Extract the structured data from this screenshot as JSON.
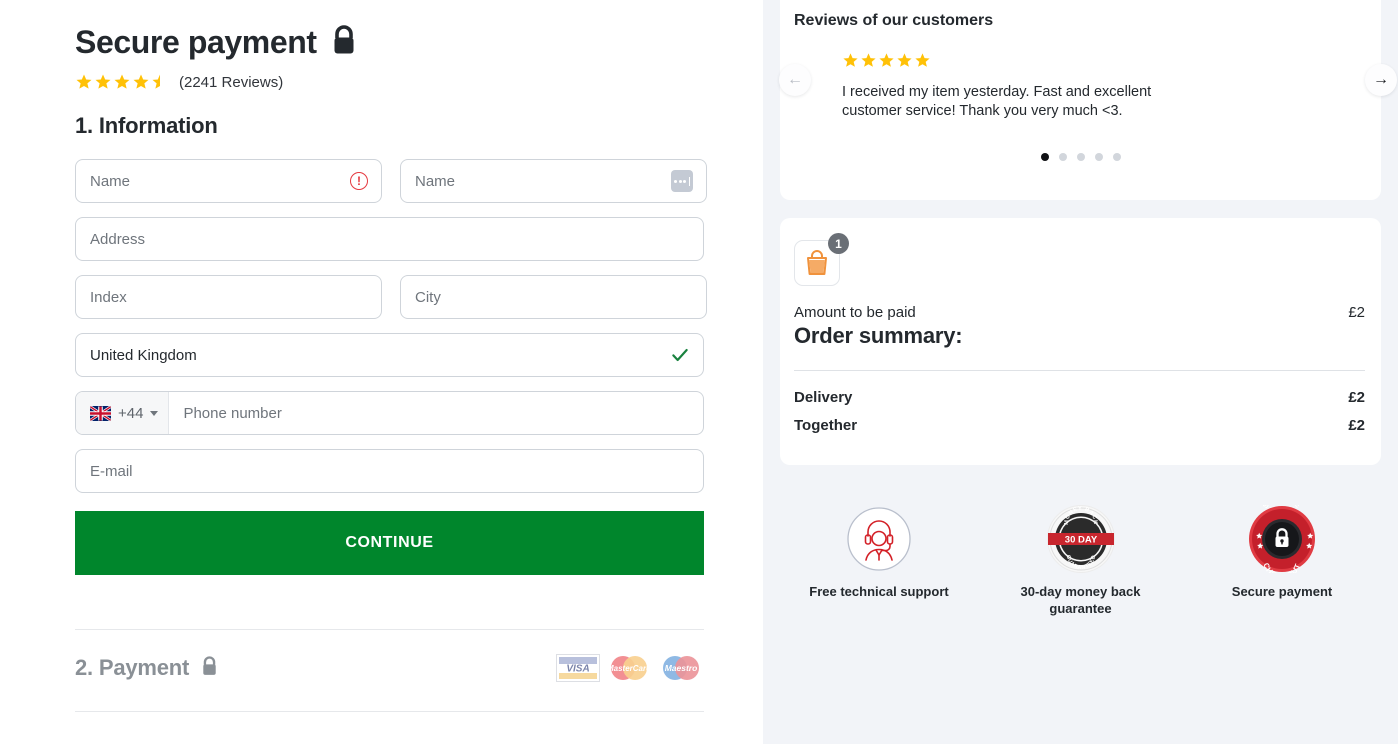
{
  "header": {
    "title": "Secure payment",
    "lock_icon": "lock-icon",
    "rating_stars": 4.5,
    "reviews_count_label": "(2241 Reviews)"
  },
  "information": {
    "heading": "1. Information",
    "fields": {
      "first_name_placeholder": "Name",
      "last_name_placeholder": "Name",
      "address_placeholder": "Address",
      "index_placeholder": "Index",
      "city_placeholder": "City",
      "country_value": "United Kingdom",
      "phone_dial_code": "+44",
      "phone_placeholder": "Phone number",
      "email_placeholder": "E-mail"
    },
    "continue_label": "CONTINUE"
  },
  "payment": {
    "heading": "2. Payment",
    "lock_icon": "lock-icon-grey",
    "cards": [
      "VISA",
      "MasterCard",
      "Maestro"
    ]
  },
  "reviews": {
    "title": "Reviews of our customers",
    "stars": 5,
    "text": "I received my item yesterday. Fast and excellent customer service! Thank you very much <3.",
    "dots_total": 5,
    "active_dot": 1,
    "prev_label": "←",
    "next_label": "→"
  },
  "order": {
    "bag_badge_count": "1",
    "amount_label": "Amount to be paid",
    "amount_value": "£2",
    "summary_title": "Order summary:",
    "rows": [
      {
        "name": "Delivery",
        "amount": "£2"
      },
      {
        "name": "Together",
        "amount": "£2"
      }
    ]
  },
  "trust_badges": [
    {
      "icon": "headset-support-icon",
      "label": "Free technical support"
    },
    {
      "icon": "money-back-seal-icon",
      "label": "30-day money back guarantee",
      "seal_top": "MONEY BACK",
      "seal_banner": "30 DAY",
      "seal_bottom": "GUARANTEED"
    },
    {
      "icon": "secure-checkout-seal-icon",
      "label": "Secure payment",
      "seal_top": "SECURE",
      "seal_bottom": "CHECKOUT"
    }
  ],
  "colors": {
    "continue_green": "#00862c",
    "star_amber": "#ffc107",
    "error_red": "#e5393f",
    "check_green": "#19823f",
    "panel_bg": "#f2f4f8",
    "bag_orange": "#f0923c",
    "seal_red": "#c8202d"
  }
}
